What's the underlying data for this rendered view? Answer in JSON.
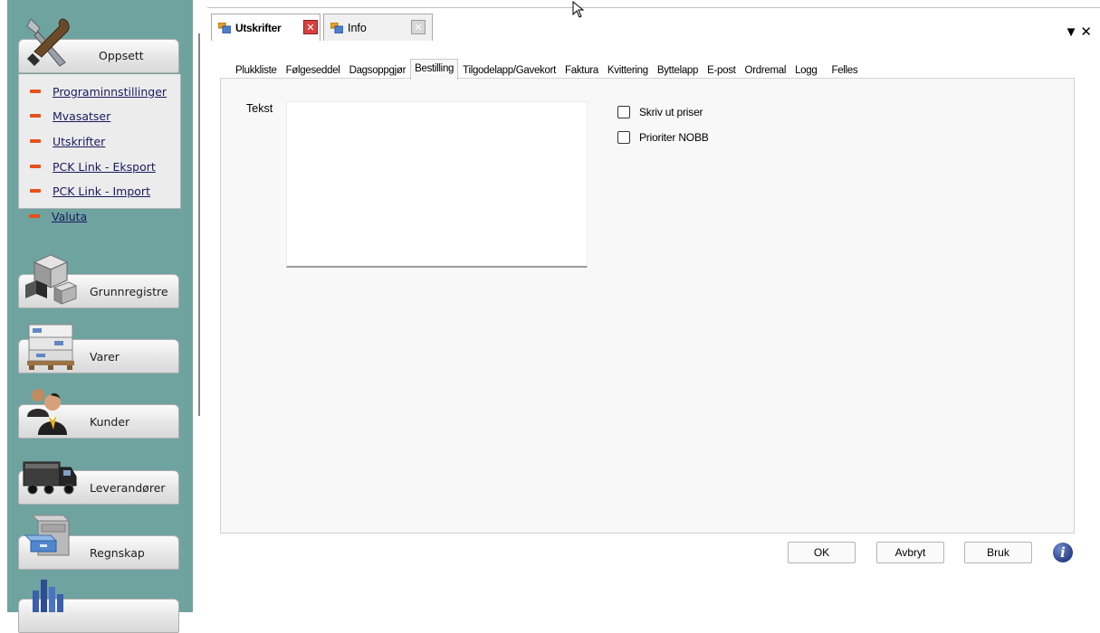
{
  "sidebar": {
    "setup_group": {
      "label": "Oppsett",
      "icon": "tools-icon",
      "items": [
        {
          "label": "Programinnstillinger"
        },
        {
          "label": "Mvasatser"
        },
        {
          "label": "Utskrifter"
        },
        {
          "label": "PCK Link - Eksport"
        },
        {
          "label": "PCK Link - Import"
        },
        {
          "label": "Valuta"
        }
      ]
    },
    "groups": [
      {
        "label": "Grunnregistre",
        "icon": "cubes-icon"
      },
      {
        "label": "Varer",
        "icon": "pallet-boxes-icon"
      },
      {
        "label": "Kunder",
        "icon": "people-icon"
      },
      {
        "label": "Leverandører",
        "icon": "truck-icon"
      },
      {
        "label": "Regnskap",
        "icon": "drawer-cabinet-icon"
      },
      {
        "label": "",
        "icon": "bar-chart-icon"
      }
    ],
    "accent_color": "#6fa3a0",
    "bullet_color": "#e8501c"
  },
  "doc_tabs": [
    {
      "label": "Utskrifter",
      "active": true,
      "close_style": "red"
    },
    {
      "label": "Info",
      "active": false,
      "close_style": "grey"
    }
  ],
  "window_controls": {
    "menu": "▼",
    "close": "✕"
  },
  "settings_tabs": [
    {
      "label": "Plukkliste"
    },
    {
      "label": "Følgeseddel"
    },
    {
      "label": "Dagsoppgjør"
    },
    {
      "label": "Bestilling",
      "active": true
    },
    {
      "label": "Tilgodelapp/Gavekort"
    },
    {
      "label": "Faktura"
    },
    {
      "label": "Kvittering"
    },
    {
      "label": "Byttelapp"
    },
    {
      "label": "E-post"
    },
    {
      "label": "Ordremal"
    },
    {
      "label": "Logg"
    },
    {
      "label": "Felles"
    }
  ],
  "form": {
    "tekst_label": "Tekst",
    "tekst_value": "",
    "checkboxes": [
      {
        "label": "Skriv ut priser",
        "checked": false
      },
      {
        "label": "Prioriter NOBB",
        "checked": false
      }
    ]
  },
  "buttons": {
    "ok": "OK",
    "cancel": "Avbryt",
    "apply": "Bruk",
    "info": "i"
  }
}
